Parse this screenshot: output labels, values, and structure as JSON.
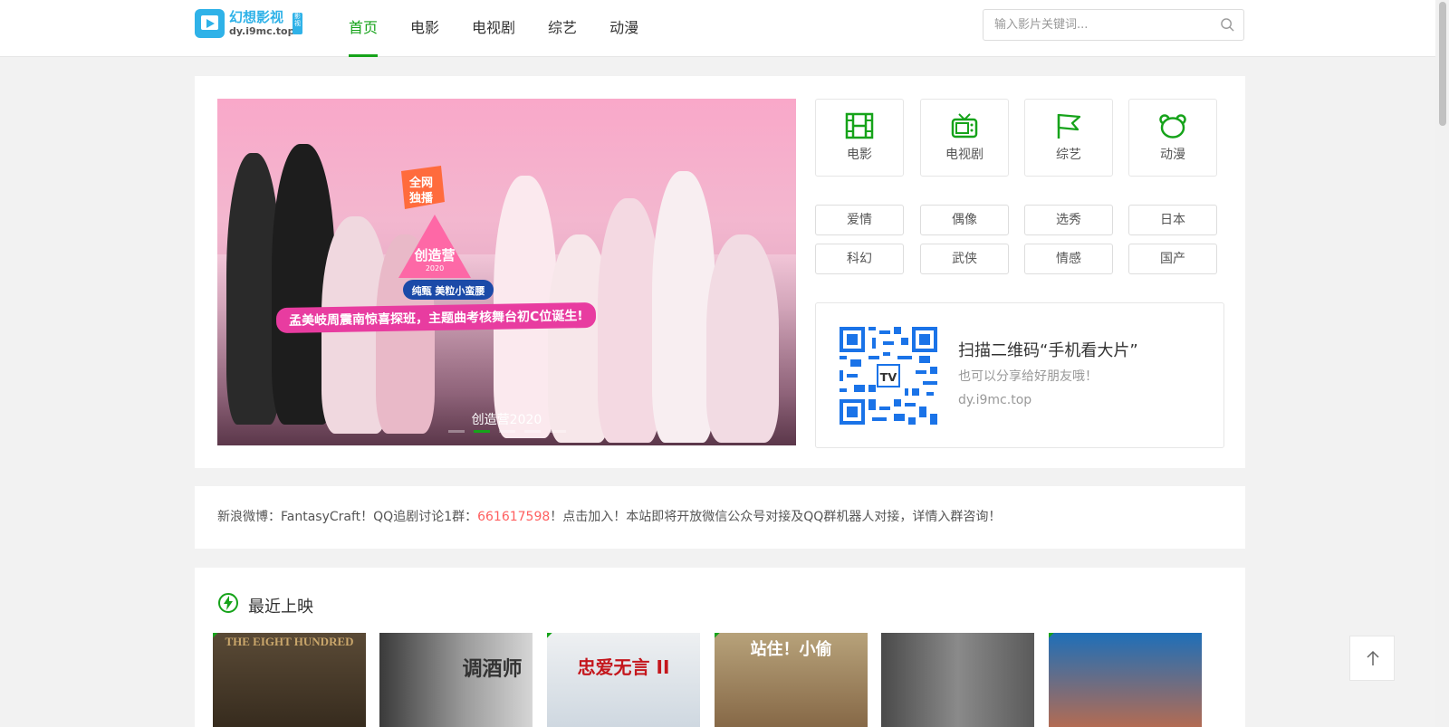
{
  "site": {
    "logo_title": "幻想影视",
    "logo_domain": "dy.i9mc.top",
    "logo_badge": "影视"
  },
  "nav": {
    "items": [
      {
        "label": "首页",
        "active": true
      },
      {
        "label": "电影",
        "active": false
      },
      {
        "label": "电视剧",
        "active": false
      },
      {
        "label": "综艺",
        "active": false
      },
      {
        "label": "动漫",
        "active": false
      }
    ]
  },
  "search": {
    "placeholder": "输入影片关键词..."
  },
  "banner": {
    "caption": "创造营2020",
    "slogan": "孟美岐周震南惊喜探班，主题曲考核舞台初C位诞生!",
    "badge_text": "全网独播",
    "camp_text": "创造营",
    "camp_year": "2020",
    "sponsor_text": "纯甄 美粒小蛮腰",
    "slide_count": 5,
    "active_slide": 2
  },
  "categories": [
    {
      "label": "电影",
      "icon": "film-icon"
    },
    {
      "label": "电视剧",
      "icon": "tv-icon"
    },
    {
      "label": "综艺",
      "icon": "flag-icon"
    },
    {
      "label": "动漫",
      "icon": "bear-icon"
    }
  ],
  "tags": [
    "爱情",
    "偶像",
    "选秀",
    "日本",
    "科幻",
    "武侠",
    "情感",
    "国产"
  ],
  "qrcode": {
    "title": "扫描二维码“手机看大片”",
    "subtitle": "也可以分享给好朋友哦！",
    "url": "dy.i9mc.top"
  },
  "notice": {
    "prefix": "新浪微博：FantasyCraft！QQ追剧讨论1群：",
    "qq": "661617598",
    "suffix": "！点击加入！本站即将开放微信公众号对接及QQ群机器人对接，详情入群咨询！"
  },
  "recent": {
    "title": "最近上映",
    "posters": [
      {
        "text": "THE EIGHT HUNDRED"
      },
      {
        "text": "调酒师"
      },
      {
        "text": "忠爱无言 II"
      },
      {
        "text": "站住！小偷"
      },
      {
        "text": ""
      },
      {
        "text": ""
      }
    ]
  },
  "colors": {
    "accent": "#16a31a",
    "highlight": "#ff5f5f"
  }
}
